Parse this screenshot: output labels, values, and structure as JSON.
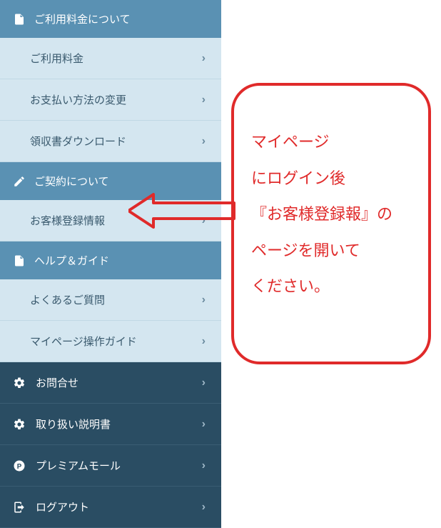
{
  "sections": {
    "fees": {
      "header": "ご利用料金について",
      "items": [
        {
          "label": "ご利用料金"
        },
        {
          "label": "お支払い方法の変更"
        },
        {
          "label": "領収書ダウンロード"
        }
      ]
    },
    "contract": {
      "header": "ご契約について",
      "items": [
        {
          "label": "お客様登録情報"
        }
      ]
    },
    "help": {
      "header": "ヘルプ＆ガイド",
      "items": [
        {
          "label": "よくあるご質問"
        },
        {
          "label": "マイページ操作ガイド"
        }
      ]
    }
  },
  "darkItems": [
    {
      "label": "お問合せ",
      "icon": "gear"
    },
    {
      "label": "取り扱い説明書",
      "icon": "gear"
    },
    {
      "label": "プレミアムモール",
      "icon": "p-circle"
    },
    {
      "label": "ログアウト",
      "icon": "logout"
    }
  ],
  "callout": {
    "line1": "マイページ",
    "line2": "にログイン後",
    "line3": "『お客様登録報』の",
    "line4": "ページを開いて",
    "line5": "ください。"
  },
  "colors": {
    "headerBg": "#5a91b3",
    "subBg": "#d4e6f0",
    "darkBg": "#2a4d63",
    "accent": "#e02a2a"
  }
}
